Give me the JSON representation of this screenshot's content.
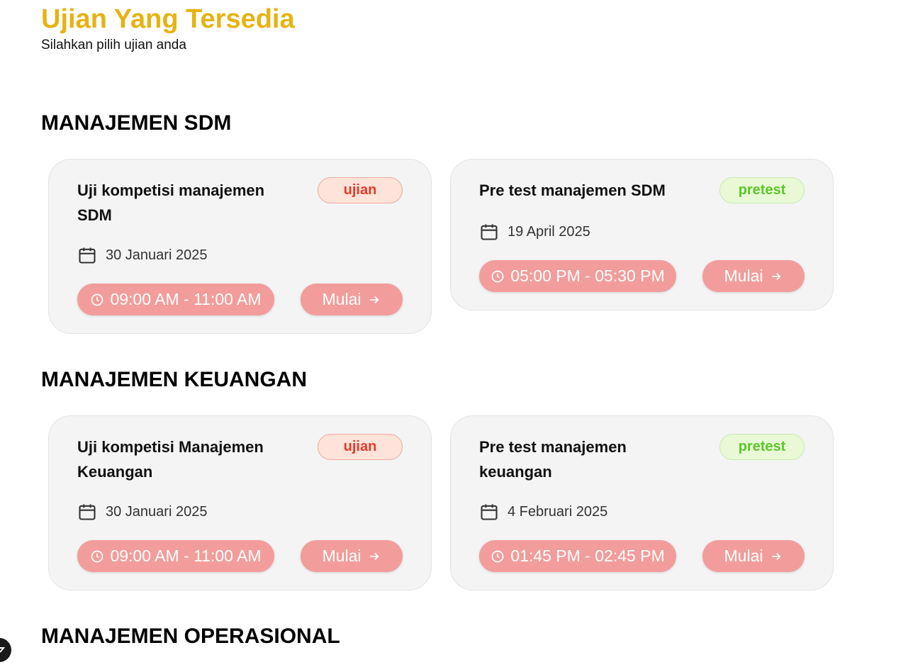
{
  "header": {
    "title": "Ujian Yang Tersedia",
    "subtitle": "Silahkan pilih ujian anda"
  },
  "colors": {
    "title": "#e5b313",
    "pill": "#f29d9b",
    "badge_ujian_bg": "#fde3d9",
    "badge_ujian_text": "#e23c2c",
    "badge_pretest_bg": "#e9f9d6",
    "badge_pretest_text": "#5cc72a"
  },
  "sections": [
    {
      "title": "MANAJEMEN SDM",
      "exams": [
        {
          "title": "Uji kompetisi manajemen SDM",
          "type": "ujian",
          "date": "30 Januari 2025",
          "time": "09:00 AM - 11:00 AM",
          "action": "Mulai"
        },
        {
          "title": "Pre test manajemen SDM",
          "type": "pretest",
          "date": "19 April 2025",
          "time": "05:00 PM - 05:30 PM",
          "action": "Mulai"
        }
      ]
    },
    {
      "title": "MANAJEMEN KEUANGAN",
      "exams": [
        {
          "title": "Uji kompetisi Manajemen Keuangan",
          "type": "ujian",
          "date": "30 Januari 2025",
          "time": "09:00 AM - 11:00 AM",
          "action": "Mulai"
        },
        {
          "title": "Pre test manajemen keuangan",
          "type": "pretest",
          "date": "4 Februari 2025",
          "time": "01:45 PM - 02:45 PM",
          "action": "Mulai"
        }
      ]
    },
    {
      "title": "MANAJEMEN OPERASIONAL",
      "exams": []
    }
  ],
  "icons": {
    "date": "calendar-icon",
    "time": "clock-icon",
    "action": "arrow-right-icon"
  }
}
